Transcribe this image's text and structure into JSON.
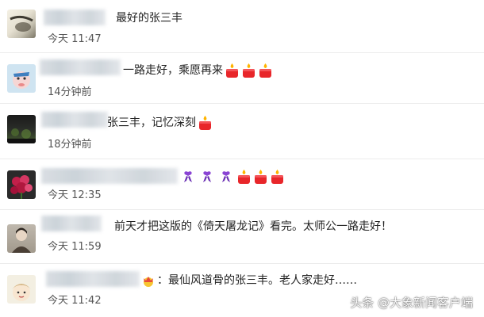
{
  "comments": [
    {
      "text": "最好的张三丰",
      "time": "今天 11:47",
      "candles": 0
    },
    {
      "text": "一路走好，乘愿再来",
      "time": "14分钟前",
      "candles": 3
    },
    {
      "text": "张三丰，记忆深刻",
      "time": "18分钟前",
      "candles": 1
    },
    {
      "text": "",
      "time": "今天 12:35",
      "candles": 3
    },
    {
      "text": "前天才把这版的《倚天屠龙记》看完。太师公一路走好！",
      "time": "今天 11:59",
      "candles": 0
    },
    {
      "text": "：最仙风道骨的张三丰。老人家走好……",
      "time": "今天 11:42",
      "candles": 0
    }
  ],
  "emoji": {
    "candle": "candle-icon",
    "ribbon": "mourning-ribbon-icon",
    "flower": "flower-icon"
  },
  "watermark": "头条 @大象新闻客户端"
}
